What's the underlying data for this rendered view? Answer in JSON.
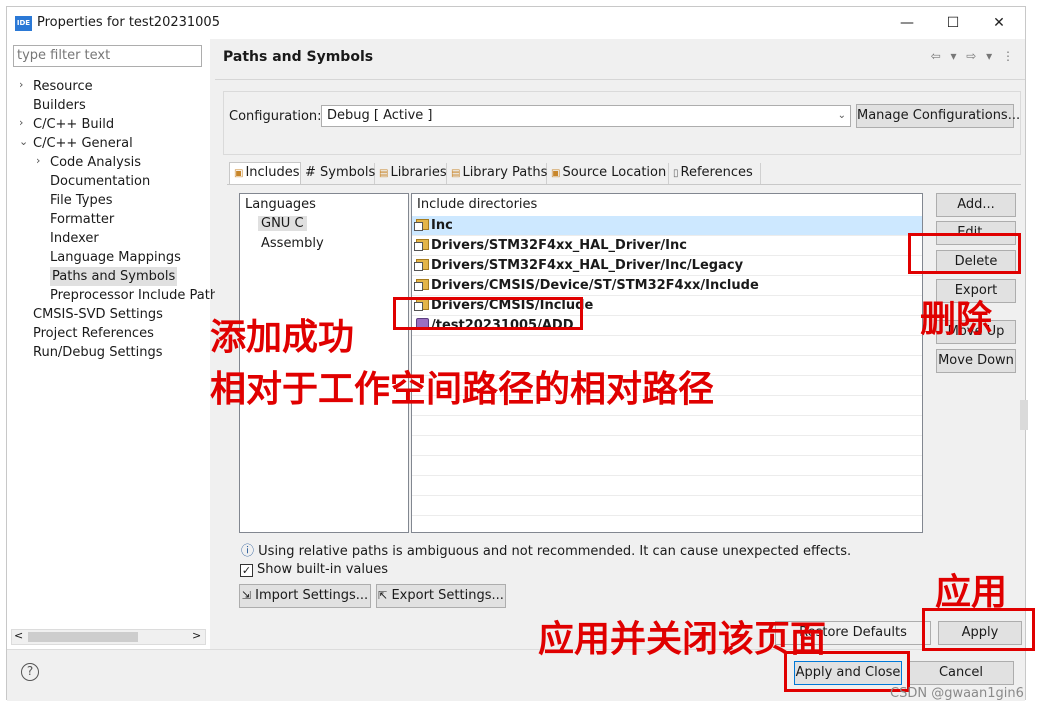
{
  "window": {
    "title": "Properties for test20231005",
    "icon_text": "IDE",
    "minimize_glyph": "—",
    "maximize_glyph": "☐",
    "close_glyph": "✕"
  },
  "left": {
    "filter_placeholder": "type filter text",
    "tree": [
      {
        "label": "Resource",
        "arrow": "›"
      },
      {
        "label": "Builders",
        "arrow": ""
      },
      {
        "label": "C/C++ Build",
        "arrow": "›"
      },
      {
        "label": "C/C++ General",
        "arrow": "⌄"
      },
      {
        "label": "Code Analysis",
        "arrow": "›"
      },
      {
        "label": "Documentation",
        "arrow": ""
      },
      {
        "label": "File Types",
        "arrow": ""
      },
      {
        "label": "Formatter",
        "arrow": ""
      },
      {
        "label": "Indexer",
        "arrow": ""
      },
      {
        "label": "Language Mappings",
        "arrow": ""
      },
      {
        "label": "Paths and Symbols",
        "arrow": ""
      },
      {
        "label": "Preprocessor Include Path",
        "arrow": ""
      },
      {
        "label": "CMSIS-SVD Settings",
        "arrow": ""
      },
      {
        "label": "Project References",
        "arrow": ""
      },
      {
        "label": "Run/Debug Settings",
        "arrow": ""
      }
    ],
    "scroll_left": "<",
    "scroll_right": ">"
  },
  "header": {
    "title": "Paths and Symbols",
    "nav": "⇦ ▾ ⇨ ▾ ⋮"
  },
  "config": {
    "label": "Configuration:",
    "value": "Debug  [ Active ]",
    "manage_button": "Manage Configurations..."
  },
  "tabs": [
    "Includes",
    "# Symbols",
    "Libraries",
    "Library Paths",
    "Source Location",
    "References"
  ],
  "languages": {
    "header": "Languages",
    "items": [
      "GNU C",
      "Assembly"
    ]
  },
  "includes": {
    "header": "Include directories",
    "rows": [
      {
        "path": "Inc",
        "icon": "folder-icon"
      },
      {
        "path": "Drivers/STM32F4xx_HAL_Driver/Inc",
        "icon": "folder-icon"
      },
      {
        "path": "Drivers/STM32F4xx_HAL_Driver/Inc/Legacy",
        "icon": "folder-icon"
      },
      {
        "path": "Drivers/CMSIS/Device/ST/STM32F4xx/Include",
        "icon": "folder-icon"
      },
      {
        "path": "Drivers/CMSIS/Include",
        "icon": "folder-icon"
      },
      {
        "path": "/test20231005/ADD",
        "icon": "workspace-icon"
      }
    ]
  },
  "side_buttons": {
    "add": "Add...",
    "edit": "Edit...",
    "delete": "Delete",
    "export": "Export",
    "move_up": "Move Up",
    "move_down": "Move Down"
  },
  "info": {
    "text": "Using relative paths is ambiguous and not recommended. It can cause unexpected effects.",
    "glyph": "ⓘ"
  },
  "options": {
    "show_builtin_label": "Show built-in values",
    "show_builtin_checked": true
  },
  "settings_buttons": {
    "import": "Import Settings...",
    "export": "Export Settings..."
  },
  "footer": {
    "restore_defaults": "Restore Defaults",
    "apply": "Apply",
    "apply_close": "Apply and Close",
    "cancel": "Cancel",
    "help_glyph": "?"
  },
  "annotations": {
    "added": "添加成功",
    "relative": "相对于工作空间路径的相对路径",
    "delete": "删除",
    "apply": "应用",
    "apply_close": "应用并关闭该页面"
  },
  "watermark": "CSDN @gwaan1gin6",
  "colors": {
    "annotation": "#e00000",
    "selection": "#cde8ff"
  }
}
